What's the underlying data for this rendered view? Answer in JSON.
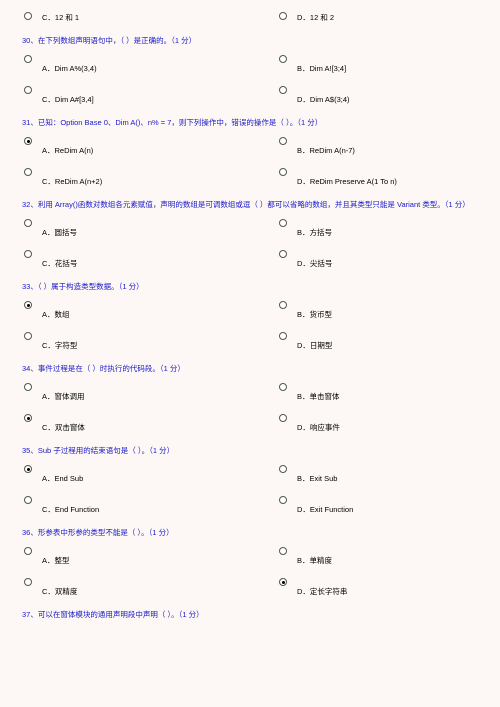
{
  "questions": [
    {
      "id": "q29tail",
      "stem": "",
      "options": [
        {
          "key": "C",
          "text": "C．12 和 1",
          "selected": false
        },
        {
          "key": "D",
          "text": "D．12 和 2",
          "selected": false
        }
      ]
    },
    {
      "id": "q30",
      "stem": "30、在下列数组声明语句中，（   ）是正确的。（1 分）",
      "options": [
        {
          "key": "A",
          "text": "A．Dim A%(3,4)",
          "selected": false
        },
        {
          "key": "B",
          "text": "B．Dim A![3;4]",
          "selected": false
        },
        {
          "key": "C",
          "text": "C．Dim A#[3,4]",
          "selected": false
        },
        {
          "key": "D",
          "text": "D．Dim A$(3;4)",
          "selected": false
        }
      ]
    },
    {
      "id": "q31",
      "stem": "31、已知：Option Base 0、Dim A()、n% = 7，则下列操作中，错误的操作是（   ）。（1 分）",
      "options": [
        {
          "key": "A",
          "text": "A．ReDim A(n)",
          "selected": true
        },
        {
          "key": "B",
          "text": "B．ReDim A(n-7)",
          "selected": false
        },
        {
          "key": "C",
          "text": "C．ReDim A(n+2)",
          "selected": false
        },
        {
          "key": "D",
          "text": "D．ReDim Preserve A(1 To n)",
          "selected": false
        }
      ]
    },
    {
      "id": "q32",
      "stem": "32、利用 Array()函数对数组各元素赋值，声明的数组是可调数组或逗（   ）都可以省略的数组，并且其类型只能是 Variant 类型。（1 分）",
      "options": [
        {
          "key": "A",
          "text": "A．圆括号",
          "selected": false
        },
        {
          "key": "B",
          "text": "B．方括号",
          "selected": false
        },
        {
          "key": "C",
          "text": "C．花括号",
          "selected": false
        },
        {
          "key": "D",
          "text": "D．尖括号",
          "selected": false
        }
      ]
    },
    {
      "id": "q33",
      "stem": "33、（   ）属于构造类型数据。（1 分）",
      "options": [
        {
          "key": "A",
          "text": "A．数组",
          "selected": true
        },
        {
          "key": "B",
          "text": "B．货币型",
          "selected": false
        },
        {
          "key": "C",
          "text": "C．字符型",
          "selected": false
        },
        {
          "key": "D",
          "text": "D．日期型",
          "selected": false
        }
      ]
    },
    {
      "id": "q34",
      "stem": "34、事件过程是在（   ）时执行的代码段。（1 分）",
      "options": [
        {
          "key": "A",
          "text": "A．窗体调用",
          "selected": false
        },
        {
          "key": "B",
          "text": "B．单击窗体",
          "selected": false
        },
        {
          "key": "C",
          "text": "C．双击窗体",
          "selected": true
        },
        {
          "key": "D",
          "text": "D．响应事件",
          "selected": false
        }
      ]
    },
    {
      "id": "q35",
      "stem": "35、Sub 子过程用的结束语句是（   ）。（1 分）",
      "options": [
        {
          "key": "A",
          "text": "A．End Sub",
          "selected": true
        },
        {
          "key": "B",
          "text": "B．Exit Sub",
          "selected": false
        },
        {
          "key": "C",
          "text": "C．End Function",
          "selected": false
        },
        {
          "key": "D",
          "text": "D．Exit Function",
          "selected": false
        }
      ]
    },
    {
      "id": "q36",
      "stem": "36、形参表中形参的类型不能是（   ）。（1 分）",
      "options": [
        {
          "key": "A",
          "text": "A．整型",
          "selected": false
        },
        {
          "key": "B",
          "text": "B．单精度",
          "selected": false
        },
        {
          "key": "C",
          "text": "C．双精度",
          "selected": false
        },
        {
          "key": "D",
          "text": "D．定长字符串",
          "selected": true
        }
      ]
    },
    {
      "id": "q37",
      "stem": "37、可以在窗体模块的通用声明段中声明（   ）。（1 分）",
      "options": []
    }
  ]
}
